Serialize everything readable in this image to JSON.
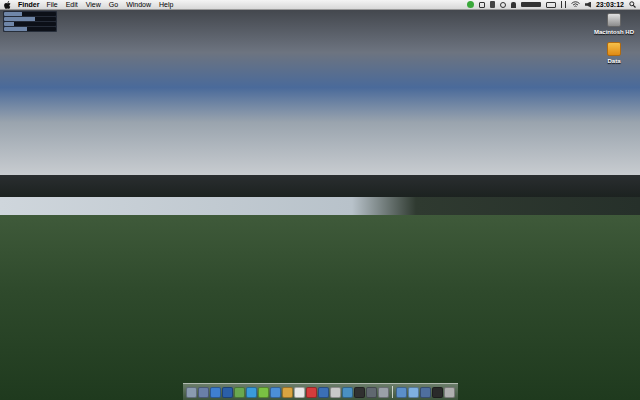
{
  "menu_bar": {
    "app": "Finder",
    "menus": [
      "File",
      "Edit",
      "View",
      "Go",
      "Window",
      "Help"
    ],
    "clock": "23:03:12"
  },
  "desktop_icons": [
    {
      "label": "Macintosh HD",
      "kind": "disk"
    },
    {
      "label": "Data",
      "kind": "folder"
    }
  ],
  "widget": {
    "rows": [
      {
        "level": 0.35
      },
      {
        "level": 0.6
      },
      {
        "level": 0.2
      },
      {
        "level": 0.45
      }
    ]
  },
  "dock": {
    "items": [
      {
        "kind": "app",
        "color": "#8a9bb0"
      },
      {
        "kind": "app",
        "color": "#6a7fa8"
      },
      {
        "kind": "app",
        "color": "#3f7fd0"
      },
      {
        "kind": "app",
        "color": "#2b5fa8"
      },
      {
        "kind": "app",
        "color": "#6aa84f"
      },
      {
        "kind": "app",
        "color": "#3a9bdc"
      },
      {
        "kind": "app",
        "color": "#7ac143"
      },
      {
        "kind": "app",
        "color": "#4c8fd6"
      },
      {
        "kind": "app",
        "color": "#d9a441"
      },
      {
        "kind": "app",
        "color": "#e8e8e8"
      },
      {
        "kind": "app",
        "color": "#d43c3c"
      },
      {
        "kind": "app",
        "color": "#3b6fb6"
      },
      {
        "kind": "app",
        "color": "#c9c9c9"
      },
      {
        "kind": "app",
        "color": "#4a90c2"
      },
      {
        "kind": "app",
        "color": "#303030"
      },
      {
        "kind": "app",
        "color": "#606870"
      },
      {
        "kind": "app",
        "color": "#9aa0a8"
      },
      {
        "kind": "separator"
      },
      {
        "kind": "app",
        "color": "#5b8fc9"
      },
      {
        "kind": "app",
        "color": "#7fb0e0"
      },
      {
        "kind": "app",
        "color": "#4f6f9f"
      },
      {
        "kind": "app",
        "color": "#2a2a2a"
      },
      {
        "kind": "app",
        "color": "#b0b0b0"
      }
    ]
  }
}
